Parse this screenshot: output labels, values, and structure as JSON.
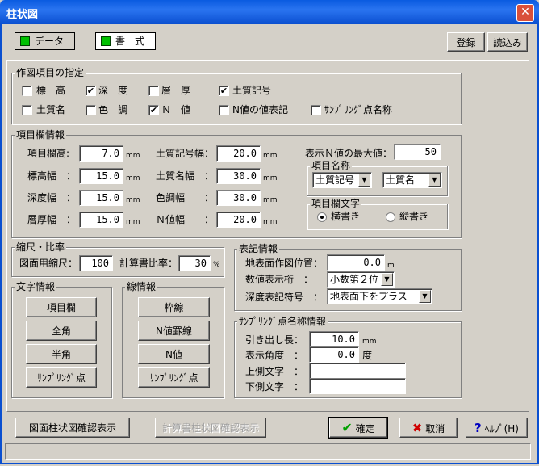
{
  "window": {
    "title": "柱状図",
    "close_glyph": "✕"
  },
  "tabs": {
    "data": "データ",
    "style": "書　式"
  },
  "toolbar": {
    "register": "登録",
    "load": "読込み"
  },
  "plot_items": {
    "label": "作図項目の指定",
    "items": [
      {
        "label": "標　高",
        "checked": false
      },
      {
        "label": "深　度",
        "checked": true
      },
      {
        "label": "層　厚",
        "checked": false
      },
      {
        "label": "土質記号",
        "checked": true
      },
      {
        "label": "土質名",
        "checked": false
      },
      {
        "label": "色　調",
        "checked": false
      },
      {
        "label": "Ｎ　値",
        "checked": true
      },
      {
        "label": "N値の値表記",
        "checked": false
      },
      {
        "label": "ｻﾝﾌﾟﾘﾝｸﾞ点名称",
        "checked": false
      }
    ]
  },
  "column_info": {
    "label": "項目欄情報",
    "unit": "mm",
    "rows": [
      {
        "label": "項目欄高:",
        "value": "7.0"
      },
      {
        "label": "標高幅　：",
        "value": "15.0"
      },
      {
        "label": "深度幅　：",
        "value": "15.0"
      },
      {
        "label": "層厚幅　：",
        "value": "15.0"
      }
    ],
    "rows2": [
      {
        "label": "土質記号幅：",
        "value": "20.0"
      },
      {
        "label": "土質名幅　：",
        "value": "30.0"
      },
      {
        "label": "色調幅　　：",
        "value": "30.0"
      },
      {
        "label": "Ｎ値幅　　：",
        "value": "20.0"
      }
    ],
    "max_n_label": "表示Ｎ値の最大値：",
    "max_n_value": "50",
    "item_name": {
      "label": "項目名称",
      "left": "土質記号",
      "right": "土質名"
    },
    "item_text": {
      "label": "項目欄文字",
      "horizontal": "横書き",
      "vertical": "縦書き"
    }
  },
  "scale": {
    "label": "縮尺・比率",
    "drawing_label": "図面用縮尺：",
    "drawing_value": "100",
    "calc_label": "計算書比率：",
    "calc_value": "30",
    "calc_unit": "%"
  },
  "text_info": {
    "label": "文字情報",
    "buttons": [
      "項目欄",
      "全角",
      "半角",
      "ｻﾝﾌﾟﾘﾝｸﾞ点"
    ]
  },
  "line_info": {
    "label": "線情報",
    "buttons": [
      "枠線",
      "N値罫線",
      "N値",
      "ｻﾝﾌﾟﾘﾝｸﾞ点"
    ]
  },
  "notation": {
    "label": "表記情報",
    "surface_label": "地表面作図位置：",
    "surface_value": "0.0",
    "surface_unit": "m",
    "digits_label": "数値表示桁　：",
    "digits_value": "小数第２位",
    "depth_label": "深度表記符号　：",
    "depth_value": "地表面下をプラス"
  },
  "sampling": {
    "label": "ｻﾝﾌﾟﾘﾝｸﾞ点名称情報",
    "lead_label": "引き出し長：",
    "lead_value": "10.0",
    "lead_unit": "mm",
    "angle_label": "表示角度　：",
    "angle_value": "0.0",
    "angle_unit": "度",
    "upper_label": "上側文字　：",
    "upper_value": "",
    "lower_label": "下側文字　：",
    "lower_value": ""
  },
  "footer": {
    "confirm_drawing": "図面柱状図確認表示",
    "confirm_calc": "計算書柱状図確認表示",
    "ok": "確定",
    "cancel": "取消",
    "help": "ﾍﾙﾌﾟ(H)"
  },
  "colors": {
    "title_blue": "#0a5be0",
    "face": "#d4d0c8",
    "indicator_green": "#00c000",
    "ok_green": "#00a000",
    "cancel_red": "#d00000",
    "help_blue": "#0000c0"
  }
}
